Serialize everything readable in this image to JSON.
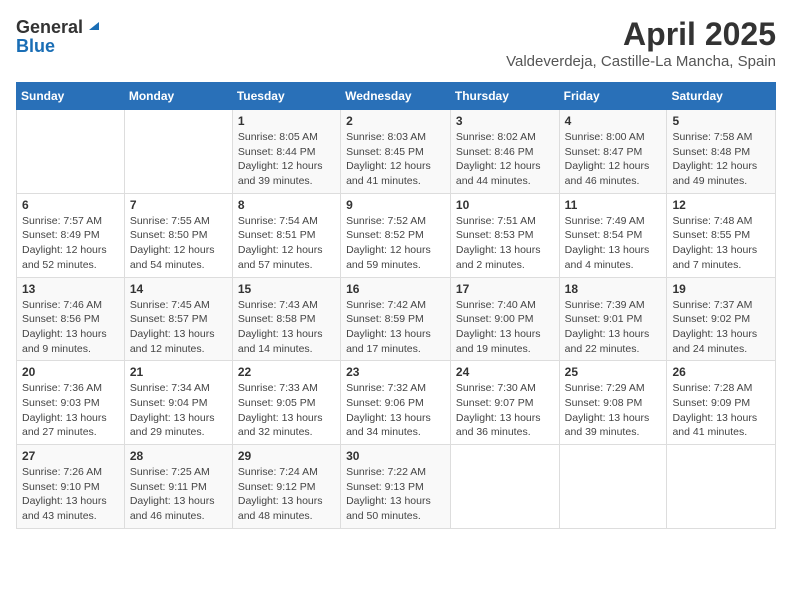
{
  "header": {
    "logo_general": "General",
    "logo_blue": "Blue",
    "month_title": "April 2025",
    "location": "Valdeverdeja, Castille-La Mancha, Spain"
  },
  "columns": [
    "Sunday",
    "Monday",
    "Tuesday",
    "Wednesday",
    "Thursday",
    "Friday",
    "Saturday"
  ],
  "weeks": [
    [
      {
        "day": "",
        "info": ""
      },
      {
        "day": "",
        "info": ""
      },
      {
        "day": "1",
        "info": "Sunrise: 8:05 AM\nSunset: 8:44 PM\nDaylight: 12 hours and 39 minutes."
      },
      {
        "day": "2",
        "info": "Sunrise: 8:03 AM\nSunset: 8:45 PM\nDaylight: 12 hours and 41 minutes."
      },
      {
        "day": "3",
        "info": "Sunrise: 8:02 AM\nSunset: 8:46 PM\nDaylight: 12 hours and 44 minutes."
      },
      {
        "day": "4",
        "info": "Sunrise: 8:00 AM\nSunset: 8:47 PM\nDaylight: 12 hours and 46 minutes."
      },
      {
        "day": "5",
        "info": "Sunrise: 7:58 AM\nSunset: 8:48 PM\nDaylight: 12 hours and 49 minutes."
      }
    ],
    [
      {
        "day": "6",
        "info": "Sunrise: 7:57 AM\nSunset: 8:49 PM\nDaylight: 12 hours and 52 minutes."
      },
      {
        "day": "7",
        "info": "Sunrise: 7:55 AM\nSunset: 8:50 PM\nDaylight: 12 hours and 54 minutes."
      },
      {
        "day": "8",
        "info": "Sunrise: 7:54 AM\nSunset: 8:51 PM\nDaylight: 12 hours and 57 minutes."
      },
      {
        "day": "9",
        "info": "Sunrise: 7:52 AM\nSunset: 8:52 PM\nDaylight: 12 hours and 59 minutes."
      },
      {
        "day": "10",
        "info": "Sunrise: 7:51 AM\nSunset: 8:53 PM\nDaylight: 13 hours and 2 minutes."
      },
      {
        "day": "11",
        "info": "Sunrise: 7:49 AM\nSunset: 8:54 PM\nDaylight: 13 hours and 4 minutes."
      },
      {
        "day": "12",
        "info": "Sunrise: 7:48 AM\nSunset: 8:55 PM\nDaylight: 13 hours and 7 minutes."
      }
    ],
    [
      {
        "day": "13",
        "info": "Sunrise: 7:46 AM\nSunset: 8:56 PM\nDaylight: 13 hours and 9 minutes."
      },
      {
        "day": "14",
        "info": "Sunrise: 7:45 AM\nSunset: 8:57 PM\nDaylight: 13 hours and 12 minutes."
      },
      {
        "day": "15",
        "info": "Sunrise: 7:43 AM\nSunset: 8:58 PM\nDaylight: 13 hours and 14 minutes."
      },
      {
        "day": "16",
        "info": "Sunrise: 7:42 AM\nSunset: 8:59 PM\nDaylight: 13 hours and 17 minutes."
      },
      {
        "day": "17",
        "info": "Sunrise: 7:40 AM\nSunset: 9:00 PM\nDaylight: 13 hours and 19 minutes."
      },
      {
        "day": "18",
        "info": "Sunrise: 7:39 AM\nSunset: 9:01 PM\nDaylight: 13 hours and 22 minutes."
      },
      {
        "day": "19",
        "info": "Sunrise: 7:37 AM\nSunset: 9:02 PM\nDaylight: 13 hours and 24 minutes."
      }
    ],
    [
      {
        "day": "20",
        "info": "Sunrise: 7:36 AM\nSunset: 9:03 PM\nDaylight: 13 hours and 27 minutes."
      },
      {
        "day": "21",
        "info": "Sunrise: 7:34 AM\nSunset: 9:04 PM\nDaylight: 13 hours and 29 minutes."
      },
      {
        "day": "22",
        "info": "Sunrise: 7:33 AM\nSunset: 9:05 PM\nDaylight: 13 hours and 32 minutes."
      },
      {
        "day": "23",
        "info": "Sunrise: 7:32 AM\nSunset: 9:06 PM\nDaylight: 13 hours and 34 minutes."
      },
      {
        "day": "24",
        "info": "Sunrise: 7:30 AM\nSunset: 9:07 PM\nDaylight: 13 hours and 36 minutes."
      },
      {
        "day": "25",
        "info": "Sunrise: 7:29 AM\nSunset: 9:08 PM\nDaylight: 13 hours and 39 minutes."
      },
      {
        "day": "26",
        "info": "Sunrise: 7:28 AM\nSunset: 9:09 PM\nDaylight: 13 hours and 41 minutes."
      }
    ],
    [
      {
        "day": "27",
        "info": "Sunrise: 7:26 AM\nSunset: 9:10 PM\nDaylight: 13 hours and 43 minutes."
      },
      {
        "day": "28",
        "info": "Sunrise: 7:25 AM\nSunset: 9:11 PM\nDaylight: 13 hours and 46 minutes."
      },
      {
        "day": "29",
        "info": "Sunrise: 7:24 AM\nSunset: 9:12 PM\nDaylight: 13 hours and 48 minutes."
      },
      {
        "day": "30",
        "info": "Sunrise: 7:22 AM\nSunset: 9:13 PM\nDaylight: 13 hours and 50 minutes."
      },
      {
        "day": "",
        "info": ""
      },
      {
        "day": "",
        "info": ""
      },
      {
        "day": "",
        "info": ""
      }
    ]
  ]
}
